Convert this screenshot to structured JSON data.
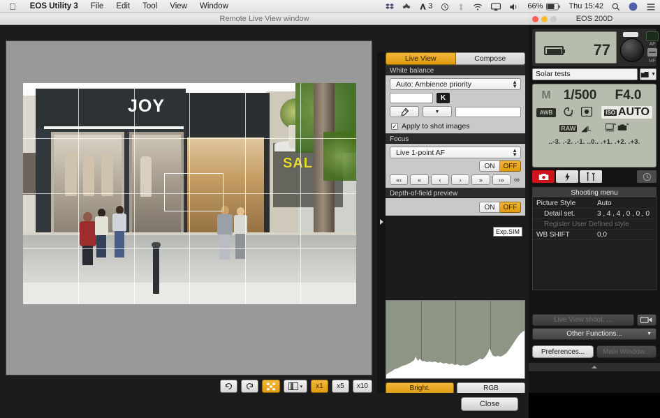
{
  "menubar": {
    "apple": "",
    "app": "EOS Utility 3",
    "items": [
      "File",
      "Edit",
      "Tool",
      "View",
      "Window"
    ],
    "status": {
      "dropbox_icon": "dropbox-icon",
      "adobe_label": "3",
      "time_machine_icon": "clock-icon",
      "bluetooth_icon": "bluetooth-icon",
      "wifi_icon": "wifi-icon",
      "airplay_icon": "airplay-icon",
      "volume_icon": "volume-icon",
      "battery_pct": "66%",
      "clock": "Thu 15:42",
      "search_icon": "search-icon",
      "siri_icon": "siri-icon",
      "notifications_icon": "list-icon"
    }
  },
  "live_view_window": {
    "title": "Remote Live View window",
    "toolbar": {
      "rotate_left": "rotate-left-icon",
      "rotate_right": "rotate-right-icon",
      "grid_toggle": "grid-icon",
      "aspect": "aspect-icon",
      "aspect_arrow": "▾",
      "zoom_x1": "x1",
      "zoom_x5": "x5",
      "zoom_x10": "x10",
      "active_zoom": "x1"
    },
    "close_button": "Close",
    "photo": {
      "shop_sign": "JOY",
      "sale_sign": "SALE"
    }
  },
  "control_panel": {
    "tabs": [
      {
        "label": "Live View",
        "active": true
      },
      {
        "label": "Compose",
        "active": false
      }
    ],
    "white_balance": {
      "header": "White balance",
      "selected": "Auto: Ambience priority",
      "kelvin_value": "",
      "kelvin_unit": "K",
      "eyedropper_icon": "eyedropper-icon",
      "dropdown_value": "",
      "coords_value": "",
      "apply_checkbox_label": "Apply to shot images",
      "apply_checked": true
    },
    "focus": {
      "header": "Focus",
      "mode": "Live 1-point AF",
      "toggle": {
        "on": "ON",
        "off": "OFF",
        "selected": "OFF"
      },
      "steps": [
        "«‹",
        "«",
        "‹",
        "›",
        "»",
        "›»"
      ],
      "infinity": "∞"
    },
    "dof_preview": {
      "header": "Depth-of-field preview",
      "toggle": {
        "on": "ON",
        "off": "OFF",
        "selected": "OFF"
      }
    },
    "exp_sim": "Exp.SIM",
    "histogram": {
      "buttons": [
        {
          "label": "Bright.",
          "active": true
        },
        {
          "label": "RGB",
          "active": false
        }
      ]
    }
  },
  "camera_panel": {
    "title": "EOS 200D",
    "shots_remaining": "77",
    "battery_icon": "battery-icon",
    "af_label": "AF",
    "mf_label": "MF",
    "folder_name": "Solar tests",
    "folder_icon": "folder-icon",
    "lcd": {
      "mode": "M",
      "shutter": "1/500",
      "aperture": "F4.0",
      "white_balance": "AWB",
      "drive_icon": "self-timer-2s-icon",
      "metering_icon": "metering-icon",
      "iso_label": "ISO",
      "iso_value": "AUTO",
      "quality_raw": "RAW",
      "quality_jpeg": "◢L",
      "transfer_icon": "pc-camera-icon",
      "exposure_scale": "..-3. .-2. .-1. ..0.. .+1. .+2. .+3."
    },
    "tabs": [
      {
        "icon": "camera-icon",
        "selected": true
      },
      {
        "icon": "flash-icon",
        "selected": false
      },
      {
        "icon": "wrench-icon",
        "selected": false
      }
    ],
    "clock_icon": "clock-icon",
    "menu": {
      "header": "Shooting menu",
      "rows": [
        {
          "key": "Picture Style",
          "value": "Auto",
          "indent": false,
          "dim": false
        },
        {
          "key": "Detail set.",
          "value": "3 , 4 , 4 , 0 , 0 , 0",
          "indent": true,
          "dim": false
        },
        {
          "key": "Register User Defined style",
          "value": "",
          "indent": true,
          "dim": true
        },
        {
          "key": "WB SHIFT",
          "value": "0,0",
          "indent": false,
          "dim": false
        }
      ]
    },
    "live_view_shoot": "Live View shoot. ...",
    "movie_icon": "movie-camera-icon",
    "other_functions": "Other Functions...",
    "other_functions_arrow": "▼",
    "preferences": "Preferences...",
    "main_window": "Main Window..."
  },
  "colors": {
    "accent": "#e09c10",
    "record_red": "#d0121b",
    "lcd_green": "#b6bdaf"
  }
}
